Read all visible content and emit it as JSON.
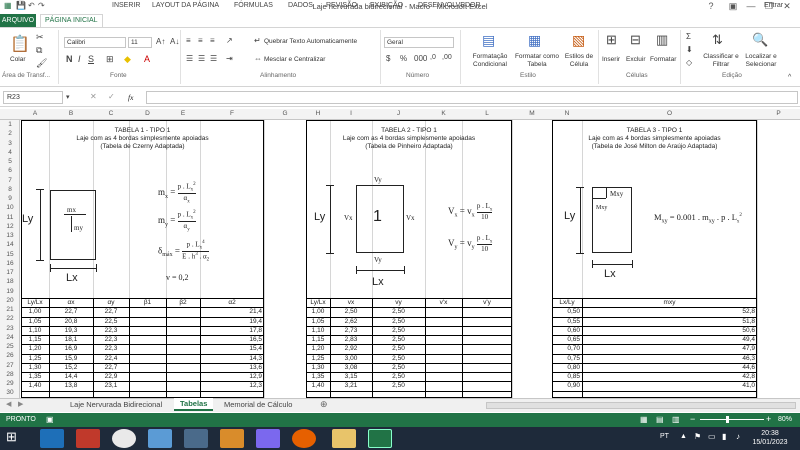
{
  "window": {
    "title": "Laje nervurada bidirecional - Macro - Microsoft Excel",
    "help": "?",
    "login": "Entrar"
  },
  "ribbon_tabs": {
    "file": "ARQUIVO",
    "home": "PÁGINA INICIAL",
    "insert": "INSERIR",
    "layout": "LAYOUT DA PÁGINA",
    "formulas": "FÓRMULAS",
    "data": "DADOS",
    "review": "REVISÃO",
    "view": "EXIBIÇÃO",
    "dev": "DESENVOLVEDOR"
  },
  "ribbon": {
    "paste": "Colar",
    "font_name": "Calibri",
    "font_size": "11",
    "wrap": "Quebrar Texto Automaticamente",
    "merge": "Mesclar e Centralizar",
    "number_format": "Geral",
    "cond": "Formatação Condicional",
    "table": "Formatar como Tabela",
    "styles": "Estilos de Célula",
    "insert": "Inserir",
    "delete": "Excluir",
    "format": "Formatar",
    "sort": "Classificar e Filtrar",
    "find": "Localizar e Selecionar",
    "groups": {
      "clip": "Área de Transf...",
      "font": "Fonte",
      "align": "Alinhamento",
      "number": "Número",
      "style": "Estilo",
      "cells": "Células",
      "edit": "Edição"
    }
  },
  "formula": {
    "namebox": "R23",
    "fx": "fx"
  },
  "columns": [
    "A",
    "B",
    "C",
    "D",
    "E",
    "F",
    "G",
    "H",
    "I",
    "J",
    "K",
    "L",
    "M",
    "N",
    "O",
    "P"
  ],
  "rows": [
    "1",
    "2",
    "3",
    "4",
    "5",
    "6",
    "7",
    "8",
    "9",
    "10",
    "11",
    "12",
    "13",
    "14",
    "15",
    "16",
    "17",
    "18",
    "19",
    "20",
    "21",
    "22",
    "23",
    "24",
    "25",
    "26",
    "27",
    "28",
    "29",
    "30"
  ],
  "t1": {
    "title": "TABELA 1 - TIPO 1",
    "sub1": "Laje com as 4 bordas simplesmente apoiadas",
    "sub2": "(Tabela de Czerny Adaptada)",
    "ly": "Ly",
    "lx": "Lx",
    "mx": "mx",
    "my": "my",
    "v": "v = 0,2",
    "headers": [
      "Ly/Lx",
      "αx",
      "αy",
      "β1",
      "β2",
      "α2"
    ],
    "data": [
      [
        "1,00",
        "22,7",
        "22,7",
        "",
        "",
        "21,4"
      ],
      [
        "1,05",
        "20,8",
        "22,5",
        "",
        "",
        "19,4"
      ],
      [
        "1,10",
        "19,3",
        "22,3",
        "",
        "",
        "17,8"
      ],
      [
        "1,15",
        "18,1",
        "22,3",
        "",
        "",
        "16,5"
      ],
      [
        "1,20",
        "16,9",
        "22,3",
        "",
        "",
        "15,4"
      ],
      [
        "1,25",
        "15,9",
        "22,4",
        "",
        "",
        "14,3"
      ],
      [
        "1,30",
        "15,2",
        "22,7",
        "",
        "",
        "13,6"
      ],
      [
        "1,35",
        "14,4",
        "22,9",
        "",
        "",
        "12,9"
      ],
      [
        "1,40",
        "13,8",
        "23,1",
        "",
        "",
        "12,3"
      ]
    ]
  },
  "t2": {
    "title": "TABELA 2 - TIPO 1",
    "sub1": "Laje com as 4 bordas simplesmente apoiadas",
    "sub2": "(Tabela de Pinheiro Adaptada)",
    "ly": "Ly",
    "lx": "Lx",
    "vy": "Vy",
    "vx": "Vx",
    "one": "1",
    "headers": [
      "Ly/Lx",
      "vx",
      "vy",
      "v'x",
      "v'y"
    ],
    "data": [
      [
        "1,00",
        "2,50",
        "2,50",
        "",
        ""
      ],
      [
        "1,05",
        "2,62",
        "2,50",
        "",
        ""
      ],
      [
        "1,10",
        "2,73",
        "2,50",
        "",
        ""
      ],
      [
        "1,15",
        "2,83",
        "2,50",
        "",
        ""
      ],
      [
        "1,20",
        "2,92",
        "2,50",
        "",
        ""
      ],
      [
        "1,25",
        "3,00",
        "2,50",
        "",
        ""
      ],
      [
        "1,30",
        "3,08",
        "2,50",
        "",
        ""
      ],
      [
        "1,35",
        "3,15",
        "2,50",
        "",
        ""
      ],
      [
        "1,40",
        "3,21",
        "2,50",
        "",
        ""
      ]
    ]
  },
  "t3": {
    "title": "TABELA 3 - TIPO 1",
    "sub1": "Laje com as 4 bordas simplesmente apoiadas",
    "sub2": "(Tabela de José Milton de Araújo Adaptada)",
    "ly": "Ly",
    "lx": "Lx",
    "mxy": "Mxy",
    "mxy2": "Mxy",
    "headers": [
      "Lx/Ly",
      "mxy"
    ],
    "data": [
      [
        "0,50",
        "52,8"
      ],
      [
        "0,55",
        "51,8"
      ],
      [
        "0,60",
        "50,6"
      ],
      [
        "0,65",
        "49,4"
      ],
      [
        "0,70",
        "47,9"
      ],
      [
        "0,75",
        "46,3"
      ],
      [
        "0,80",
        "44,6"
      ],
      [
        "0,85",
        "42,8"
      ],
      [
        "0,90",
        "41,0"
      ]
    ]
  },
  "sheets": [
    "Laje Nervurada Bidirecional",
    "Tabelas",
    "Memorial de Cálculo"
  ],
  "status": {
    "ready": "PRONTO",
    "zoom": "80%"
  },
  "clock": {
    "lang": "PT",
    "time": "20:38",
    "date": "15/01/2023"
  }
}
